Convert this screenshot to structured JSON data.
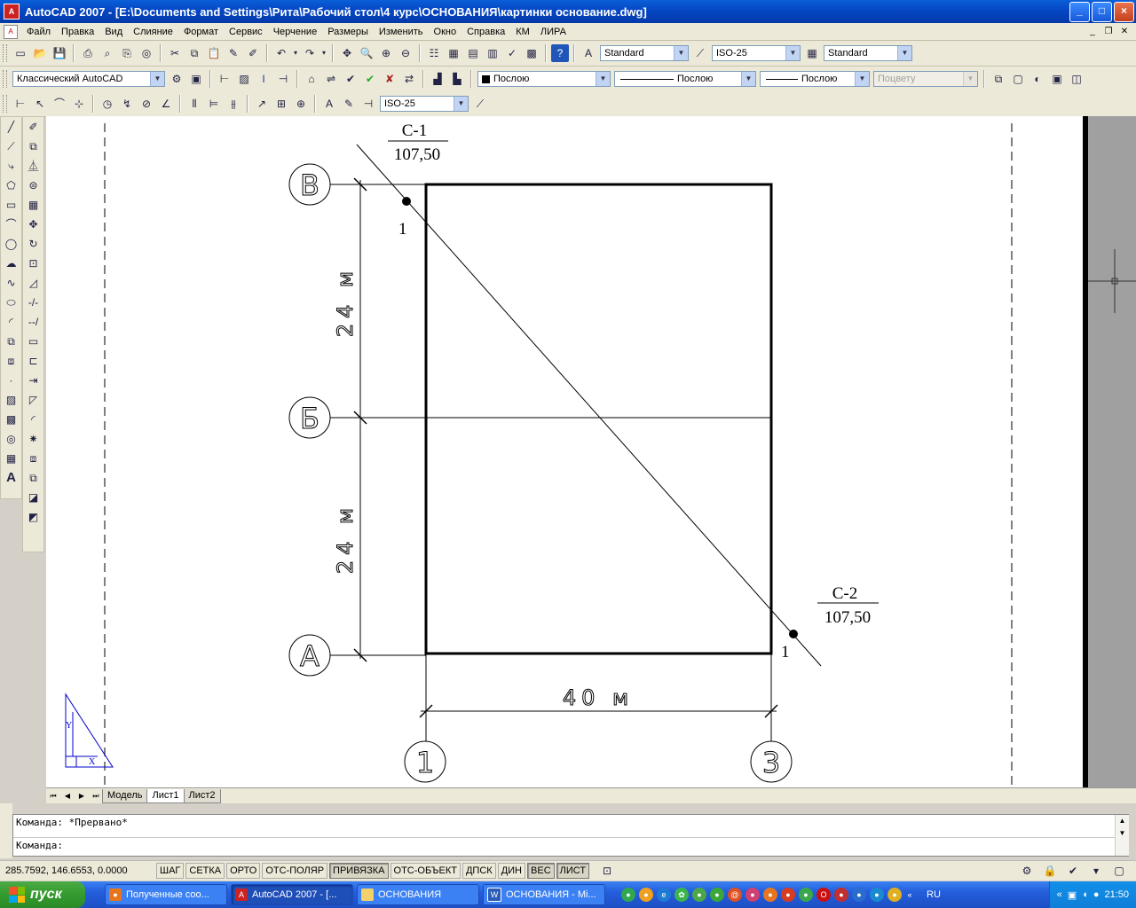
{
  "window": {
    "title": "AutoCAD 2007 - [E:\\Documents and Settings\\Рита\\Рабочий стол\\4 курс\\ОСНОВАНИЯ\\картинки основание.dwg]",
    "minimize": "_",
    "maximize": "□",
    "close": "×"
  },
  "menu": [
    "Файл",
    "Правка",
    "Вид",
    "Слияние",
    "Формат",
    "Сервис",
    "Черчение",
    "Размеры",
    "Изменить",
    "Окно",
    "Справка",
    "КМ",
    "ЛИРА"
  ],
  "toolbars": {
    "text_style": "Standard",
    "dim_style": "ISO-25",
    "table_style": "Standard",
    "workspace": "Классический AutoCAD",
    "color": "Послою",
    "linetype": "Послою",
    "lineweight": "Послою",
    "plot_style": "Поцвету",
    "dim_style_2": "ISO-25"
  },
  "drawing": {
    "section1_label": "С-1",
    "section1_elev": "107,50",
    "section2_label": "С-2",
    "section2_elev": "107,50",
    "point1_label": "1",
    "point2_label": "1",
    "axis_v": "В",
    "axis_b": "Б",
    "axis_a": "А",
    "axis_1": "1",
    "axis_3": "3",
    "dim_top": "24 м",
    "dim_bottom": "24 м",
    "dim_horizontal": "40 м",
    "ucs_y": "Y",
    "ucs_x": "X"
  },
  "layout_tabs": [
    "Модель",
    "Лист1",
    "Лист2"
  ],
  "active_tab": "Лист1",
  "command": {
    "history": "Команда: *Прервано*",
    "prompt": "Команда:"
  },
  "status": {
    "coords": "285.7592, 146.6553, 0.0000",
    "buttons": [
      "ШАГ",
      "СЕТКА",
      "ОРТО",
      "ОТС-ПОЛЯР",
      "ПРИВЯЗКА",
      "ОТС-ОБЪЕКТ",
      "ДПСК",
      "ДИН",
      "ВЕС",
      "ЛИСТ"
    ],
    "on_buttons": [
      "ПРИВЯЗКА",
      "ВЕС",
      "ЛИСТ"
    ]
  },
  "taskbar": {
    "start": "пуск",
    "tasks": [
      "Полученные соо...",
      "AutoCAD 2007 - [...",
      "ОСНОВАНИЯ",
      "ОСНОВАНИЯ - Mi..."
    ],
    "active_task": "AutoCAD 2007 - [...",
    "language": "RU",
    "clock": "21:50"
  }
}
